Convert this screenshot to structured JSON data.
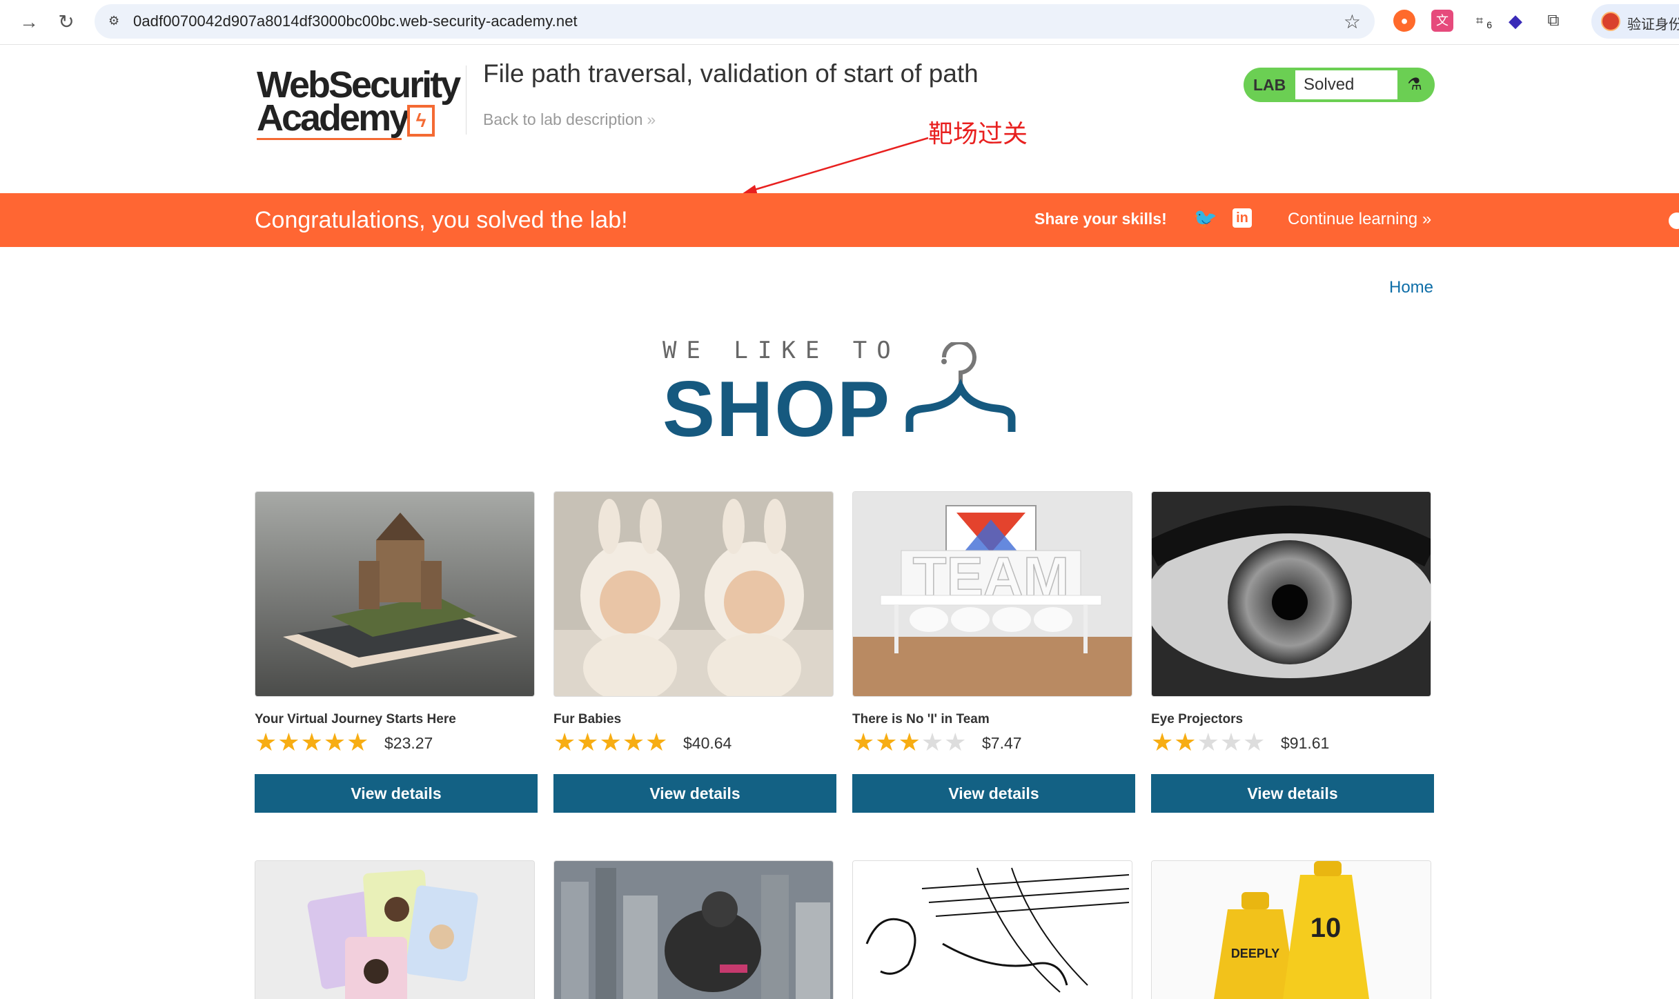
{
  "browser": {
    "url": "0adf0070042d907a8014df3000bc00bc.web-security-academy.net",
    "profile_label": "验证身份",
    "extension_badge": "6"
  },
  "header": {
    "logo_line1": "WebSecurity",
    "logo_line2": "Academy",
    "lab_title": "File path traversal, validation of start of path",
    "back_link": "Back to lab description",
    "lab_badge": "LAB",
    "lab_status": "Solved"
  },
  "annotation": {
    "text": "靶场过关",
    "color": "#e8201f"
  },
  "banner": {
    "message": "Congratulations, you solved the lab!",
    "share": "Share your skills!",
    "continue": "Continue learning",
    "color": "#ff6633"
  },
  "shop": {
    "home": "Home",
    "tagline": "WE LIKE TO",
    "title": "SHOP"
  },
  "products": [
    {
      "name": "Your Virtual Journey Starts Here",
      "rating": 5,
      "price": "$23.27",
      "button": "View details"
    },
    {
      "name": "Fur Babies",
      "rating": 5,
      "price": "$40.64",
      "button": "View details"
    },
    {
      "name": "There is No 'I' in Team",
      "rating": 3,
      "price": "$7.47",
      "button": "View details"
    },
    {
      "name": "Eye Projectors",
      "rating": 2,
      "price": "$91.61",
      "button": "View details"
    }
  ],
  "colors": {
    "primary": "#136184",
    "star": "#f7ad13",
    "lab_green": "#6bcf53"
  }
}
